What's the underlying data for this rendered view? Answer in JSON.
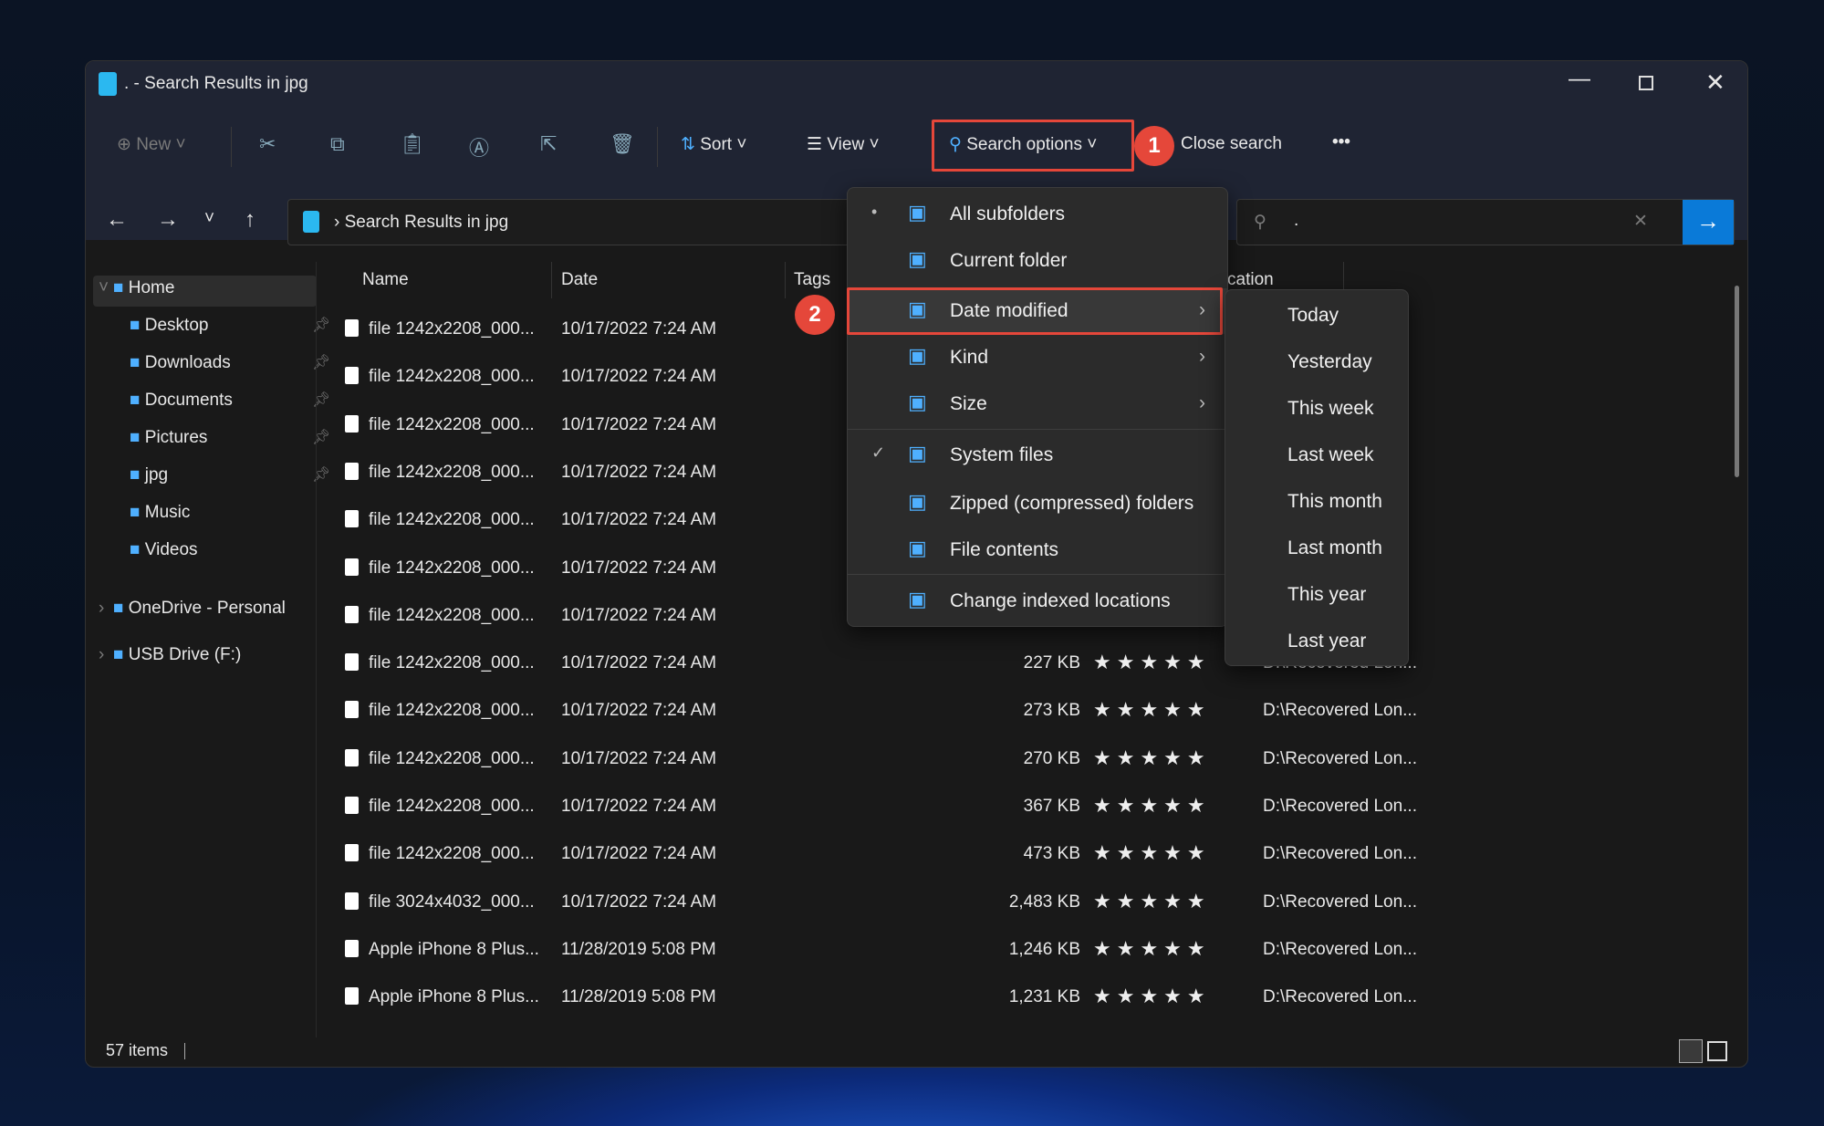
{
  "window": {
    "title": ". - Search Results in jpg"
  },
  "toolbar": {
    "new_label": "New",
    "sort_label": "Sort",
    "view_label": "View",
    "search_options_label": "Search options",
    "close_search_label": "Close search",
    "more_label": "•••"
  },
  "address": {
    "path": "Search Results in jpg"
  },
  "search": {
    "value": "."
  },
  "sidebar": {
    "items": [
      {
        "label": "Home",
        "icon": "home-icon",
        "pinned": false
      },
      {
        "label": "Desktop",
        "icon": "desktop-icon",
        "pinned": true
      },
      {
        "label": "Downloads",
        "icon": "download-icon",
        "pinned": true
      },
      {
        "label": "Documents",
        "icon": "document-icon",
        "pinned": true
      },
      {
        "label": "Pictures",
        "icon": "pictures-icon",
        "pinned": true
      },
      {
        "label": "jpg",
        "icon": "folder-icon",
        "pinned": true
      },
      {
        "label": "Music",
        "icon": "music-icon",
        "pinned": false
      },
      {
        "label": "Videos",
        "icon": "videos-icon",
        "pinned": false
      },
      {
        "label": "OneDrive - Personal",
        "icon": "cloud-icon",
        "pinned": false
      },
      {
        "label": "USB Drive (F:)",
        "icon": "drive-icon",
        "pinned": false
      }
    ]
  },
  "columns": {
    "name": "Name",
    "date": "Date",
    "tags": "Tags",
    "location": "cation"
  },
  "files": [
    {
      "name": "file 1242x2208_000...",
      "date": "10/17/2022 7:24 AM",
      "size": "",
      "location": ""
    },
    {
      "name": "file 1242x2208_000...",
      "date": "10/17/2022 7:24 AM",
      "size": "",
      "location": ""
    },
    {
      "name": "file 1242x2208_000...",
      "date": "10/17/2022 7:24 AM",
      "size": "",
      "location": ""
    },
    {
      "name": "file 1242x2208_000...",
      "date": "10/17/2022 7:24 AM",
      "size": "",
      "location": ""
    },
    {
      "name": "file 1242x2208_000...",
      "date": "10/17/2022 7:24 AM",
      "size": "",
      "location": ""
    },
    {
      "name": "file 1242x2208_000...",
      "date": "10/17/2022 7:24 AM",
      "size": "",
      "location": ""
    },
    {
      "name": "file 1242x2208_000...",
      "date": "10/17/2022 7:24 AM",
      "size": "",
      "location": ""
    },
    {
      "name": "file 1242x2208_000...",
      "date": "10/17/2022 7:24 AM",
      "size": "227 KB",
      "location": "D:\\Recovered Lon..."
    },
    {
      "name": "file 1242x2208_000...",
      "date": "10/17/2022 7:24 AM",
      "size": "273 KB",
      "location": "D:\\Recovered Lon..."
    },
    {
      "name": "file 1242x2208_000...",
      "date": "10/17/2022 7:24 AM",
      "size": "270 KB",
      "location": "D:\\Recovered Lon..."
    },
    {
      "name": "file 1242x2208_000...",
      "date": "10/17/2022 7:24 AM",
      "size": "367 KB",
      "location": "D:\\Recovered Lon..."
    },
    {
      "name": "file 1242x2208_000...",
      "date": "10/17/2022 7:24 AM",
      "size": "473 KB",
      "location": "D:\\Recovered Lon..."
    },
    {
      "name": "file 3024x4032_000...",
      "date": "10/17/2022 7:24 AM",
      "size": "2,483 KB",
      "location": "D:\\Recovered Lon..."
    },
    {
      "name": "Apple iPhone 8 Plus...",
      "date": "11/28/2019 5:08 PM",
      "size": "1,246 KB",
      "location": "D:\\Recovered Lon..."
    },
    {
      "name": "Apple iPhone 8 Plus...",
      "date": "11/28/2019 5:08 PM",
      "size": "1,231 KB",
      "location": "D:\\Recovered Lon..."
    }
  ],
  "rating_stars": "★★★★★",
  "menu": {
    "items": [
      {
        "label": "All subfolders",
        "icon": "subfolders-icon",
        "mark": "•",
        "submenu": false
      },
      {
        "label": "Current folder",
        "icon": "folder-icon",
        "mark": "",
        "submenu": false
      },
      {
        "label": "Date modified",
        "icon": "calendar-icon",
        "mark": "",
        "submenu": true
      },
      {
        "label": "Kind",
        "icon": "kind-icon",
        "mark": "",
        "submenu": true
      },
      {
        "label": "Size",
        "icon": "file-size-icon",
        "mark": "",
        "submenu": true
      },
      {
        "label": "System files",
        "icon": "system-file-icon",
        "mark": "✓",
        "submenu": false
      },
      {
        "label": "Zipped (compressed) folders",
        "icon": "zip-folder-icon",
        "mark": "",
        "submenu": false
      },
      {
        "label": "File contents",
        "icon": "file-search-icon",
        "mark": "",
        "submenu": false
      },
      {
        "label": "Change indexed locations",
        "icon": "index-locations-icon",
        "mark": "",
        "submenu": false
      }
    ]
  },
  "submenu": {
    "items": [
      "Today",
      "Yesterday",
      "This week",
      "Last week",
      "This month",
      "Last month",
      "This year",
      "Last year"
    ]
  },
  "badges": {
    "one": "1",
    "two": "2"
  },
  "status": {
    "count": "57 items"
  },
  "colors": {
    "accent": "#0a7ad8",
    "highlight": "#e5473a"
  }
}
